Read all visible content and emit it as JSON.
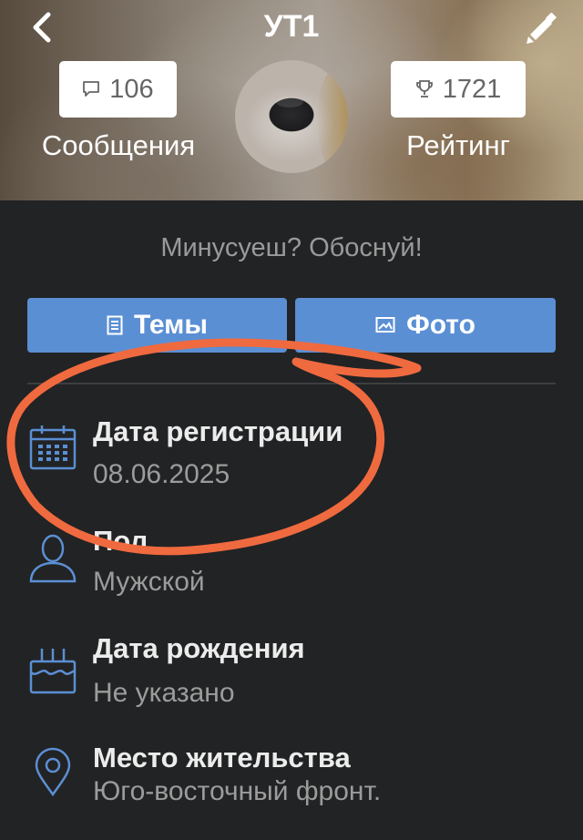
{
  "header": {
    "title": "УТ1",
    "messages_count": "106",
    "messages_label": "Сообщения",
    "rating_count": "1721",
    "rating_label": "Рейтинг",
    "back_icon": "chevron-left-icon",
    "edit_icon": "pencil-icon",
    "messages_icon": "speech-bubble-icon",
    "rating_icon": "trophy-icon"
  },
  "status": {
    "motto": "Минусуеш? Обоснуй!"
  },
  "tabs": [
    {
      "label": "Темы",
      "icon": "document-icon"
    },
    {
      "label": "Фото",
      "icon": "image-icon"
    }
  ],
  "info": [
    {
      "label": "Дата регистрации",
      "value": "08.06.2025",
      "icon": "calendar-icon"
    },
    {
      "label": "Пол",
      "value": "Мужской",
      "icon": "user-icon"
    },
    {
      "label": "Дата рождения",
      "value": "Не указано",
      "icon": "cake-icon"
    },
    {
      "label": "Место жительства",
      "value": "Юго-восточный фронт.",
      "icon": "location-pin-icon"
    }
  ],
  "colors": {
    "background": "#222324",
    "accent": "#5b8fd4",
    "icon": "#5b8fd4",
    "annotation": "#f06a3f"
  }
}
